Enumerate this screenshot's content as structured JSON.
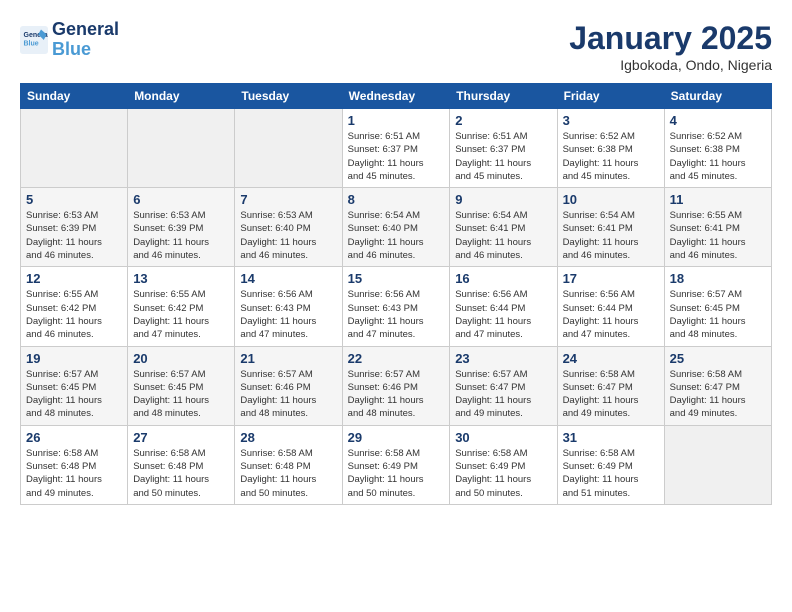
{
  "header": {
    "logo_line1": "General",
    "logo_line2": "Blue",
    "title": "January 2025",
    "subtitle": "Igbokoda, Ondo, Nigeria"
  },
  "weekdays": [
    "Sunday",
    "Monday",
    "Tuesday",
    "Wednesday",
    "Thursday",
    "Friday",
    "Saturday"
  ],
  "weeks": [
    [
      {
        "day": "",
        "info": ""
      },
      {
        "day": "",
        "info": ""
      },
      {
        "day": "",
        "info": ""
      },
      {
        "day": "1",
        "info": "Sunrise: 6:51 AM\nSunset: 6:37 PM\nDaylight: 11 hours\nand 45 minutes."
      },
      {
        "day": "2",
        "info": "Sunrise: 6:51 AM\nSunset: 6:37 PM\nDaylight: 11 hours\nand 45 minutes."
      },
      {
        "day": "3",
        "info": "Sunrise: 6:52 AM\nSunset: 6:38 PM\nDaylight: 11 hours\nand 45 minutes."
      },
      {
        "day": "4",
        "info": "Sunrise: 6:52 AM\nSunset: 6:38 PM\nDaylight: 11 hours\nand 45 minutes."
      }
    ],
    [
      {
        "day": "5",
        "info": "Sunrise: 6:53 AM\nSunset: 6:39 PM\nDaylight: 11 hours\nand 46 minutes."
      },
      {
        "day": "6",
        "info": "Sunrise: 6:53 AM\nSunset: 6:39 PM\nDaylight: 11 hours\nand 46 minutes."
      },
      {
        "day": "7",
        "info": "Sunrise: 6:53 AM\nSunset: 6:40 PM\nDaylight: 11 hours\nand 46 minutes."
      },
      {
        "day": "8",
        "info": "Sunrise: 6:54 AM\nSunset: 6:40 PM\nDaylight: 11 hours\nand 46 minutes."
      },
      {
        "day": "9",
        "info": "Sunrise: 6:54 AM\nSunset: 6:41 PM\nDaylight: 11 hours\nand 46 minutes."
      },
      {
        "day": "10",
        "info": "Sunrise: 6:54 AM\nSunset: 6:41 PM\nDaylight: 11 hours\nand 46 minutes."
      },
      {
        "day": "11",
        "info": "Sunrise: 6:55 AM\nSunset: 6:41 PM\nDaylight: 11 hours\nand 46 minutes."
      }
    ],
    [
      {
        "day": "12",
        "info": "Sunrise: 6:55 AM\nSunset: 6:42 PM\nDaylight: 11 hours\nand 46 minutes."
      },
      {
        "day": "13",
        "info": "Sunrise: 6:55 AM\nSunset: 6:42 PM\nDaylight: 11 hours\nand 47 minutes."
      },
      {
        "day": "14",
        "info": "Sunrise: 6:56 AM\nSunset: 6:43 PM\nDaylight: 11 hours\nand 47 minutes."
      },
      {
        "day": "15",
        "info": "Sunrise: 6:56 AM\nSunset: 6:43 PM\nDaylight: 11 hours\nand 47 minutes."
      },
      {
        "day": "16",
        "info": "Sunrise: 6:56 AM\nSunset: 6:44 PM\nDaylight: 11 hours\nand 47 minutes."
      },
      {
        "day": "17",
        "info": "Sunrise: 6:56 AM\nSunset: 6:44 PM\nDaylight: 11 hours\nand 47 minutes."
      },
      {
        "day": "18",
        "info": "Sunrise: 6:57 AM\nSunset: 6:45 PM\nDaylight: 11 hours\nand 48 minutes."
      }
    ],
    [
      {
        "day": "19",
        "info": "Sunrise: 6:57 AM\nSunset: 6:45 PM\nDaylight: 11 hours\nand 48 minutes."
      },
      {
        "day": "20",
        "info": "Sunrise: 6:57 AM\nSunset: 6:45 PM\nDaylight: 11 hours\nand 48 minutes."
      },
      {
        "day": "21",
        "info": "Sunrise: 6:57 AM\nSunset: 6:46 PM\nDaylight: 11 hours\nand 48 minutes."
      },
      {
        "day": "22",
        "info": "Sunrise: 6:57 AM\nSunset: 6:46 PM\nDaylight: 11 hours\nand 48 minutes."
      },
      {
        "day": "23",
        "info": "Sunrise: 6:57 AM\nSunset: 6:47 PM\nDaylight: 11 hours\nand 49 minutes."
      },
      {
        "day": "24",
        "info": "Sunrise: 6:58 AM\nSunset: 6:47 PM\nDaylight: 11 hours\nand 49 minutes."
      },
      {
        "day": "25",
        "info": "Sunrise: 6:58 AM\nSunset: 6:47 PM\nDaylight: 11 hours\nand 49 minutes."
      }
    ],
    [
      {
        "day": "26",
        "info": "Sunrise: 6:58 AM\nSunset: 6:48 PM\nDaylight: 11 hours\nand 49 minutes."
      },
      {
        "day": "27",
        "info": "Sunrise: 6:58 AM\nSunset: 6:48 PM\nDaylight: 11 hours\nand 50 minutes."
      },
      {
        "day": "28",
        "info": "Sunrise: 6:58 AM\nSunset: 6:48 PM\nDaylight: 11 hours\nand 50 minutes."
      },
      {
        "day": "29",
        "info": "Sunrise: 6:58 AM\nSunset: 6:49 PM\nDaylight: 11 hours\nand 50 minutes."
      },
      {
        "day": "30",
        "info": "Sunrise: 6:58 AM\nSunset: 6:49 PM\nDaylight: 11 hours\nand 50 minutes."
      },
      {
        "day": "31",
        "info": "Sunrise: 6:58 AM\nSunset: 6:49 PM\nDaylight: 11 hours\nand 51 minutes."
      },
      {
        "day": "",
        "info": ""
      }
    ]
  ]
}
